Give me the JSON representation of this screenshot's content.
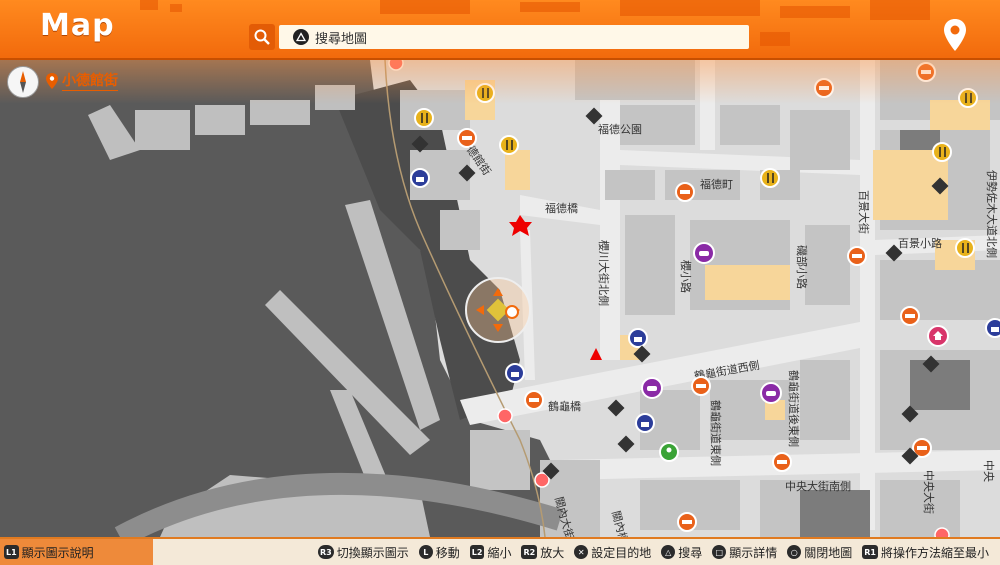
{
  "header": {
    "title": "Map",
    "search_placeholder": "搜尋地圖"
  },
  "location": {
    "name": "小德館街"
  },
  "map_labels": {
    "fukutoku_park": "福德公園",
    "fukutoku_bridge": "福德橋",
    "fukutoku_cho": "福德町",
    "kotoku_street": "小德館街",
    "hyakkei_avenue": "百景大街",
    "hyakkei_lane": "百景小路",
    "ise_street": "伊勢佐木大道北側",
    "nohara_lane": "櫻小路",
    "sakuragawa": "櫻川大街北側",
    "okuno_lane": "磯部小路",
    "tsuru_bridge": "鶴龜橋",
    "tsuru_west": "鶴龜街道西側",
    "tsuru_east": "鶴龜街道東側",
    "tsuru_east2": "鶴龜街道後東側",
    "chuo_south": "中央大街南側",
    "chuo_north": "中央大街",
    "kanai": "關內大街",
    "kanai_bridge": "關內橋",
    "right_edge": "中央"
  },
  "bottom_bar": {
    "left_button": "L1",
    "left_label": "顯示圖示說明",
    "hints": [
      {
        "button": "R3",
        "label": "切換顯示圖示"
      },
      {
        "button": "L",
        "label": "移動"
      },
      {
        "button": "L2",
        "label": "縮小"
      },
      {
        "button": "R2",
        "label": "放大"
      },
      {
        "button": "✕",
        "label": "設定目的地"
      },
      {
        "button": "△",
        "label": "搜尋"
      },
      {
        "button": "□",
        "label": "顯示詳情"
      },
      {
        "button": "○",
        "label": "關閉地圖"
      },
      {
        "button": "R1",
        "label": "將操作方法縮至最小"
      }
    ]
  },
  "colors": {
    "header_orange": "#f26a0c",
    "water": "#5a5a5a",
    "road": "#e9e9e9",
    "building": "#bdbdbd",
    "highlight": "#f7d69a"
  }
}
